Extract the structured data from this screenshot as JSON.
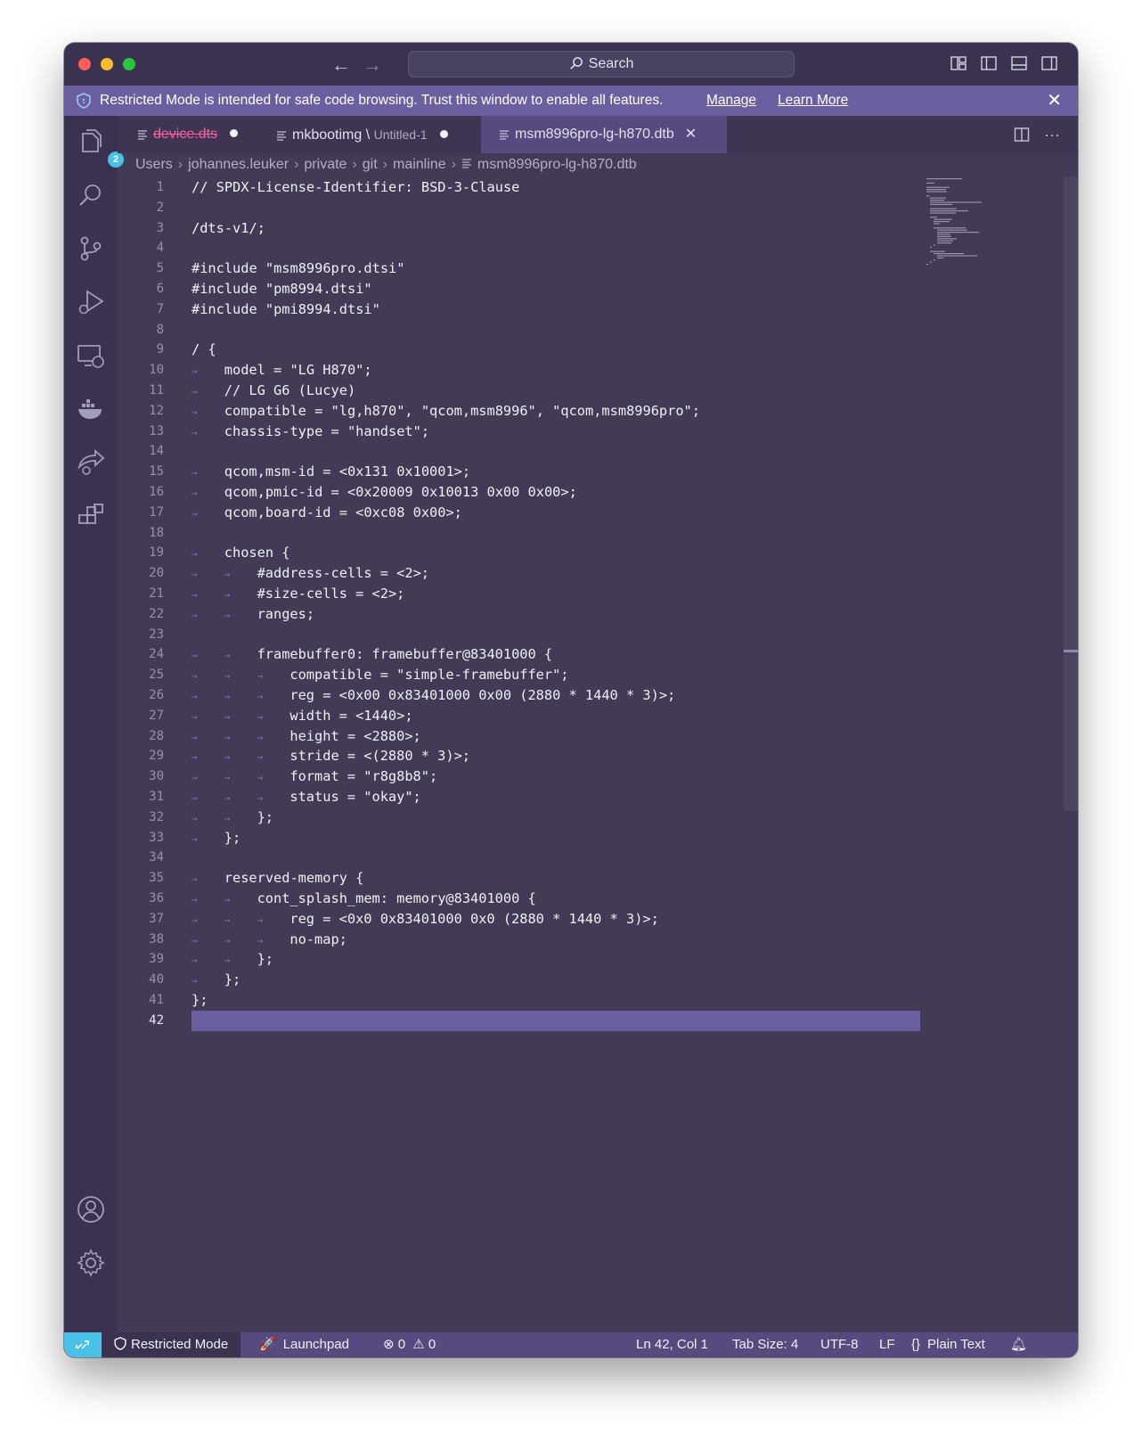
{
  "titlebar": {
    "search_label": "Search"
  },
  "banner": {
    "message": "Restricted Mode is intended for safe code browsing. Trust this window to enable all features.",
    "manage": "Manage",
    "learn_more": "Learn More"
  },
  "activity": {
    "explorer_badge": "2"
  },
  "tabs": [
    {
      "label": "device.dts",
      "dirty": true
    },
    {
      "label": "mkbootimg \\",
      "detail": "Untitled-1",
      "dirty": true
    },
    {
      "label": "msm8996pro-lg-h870.dtb",
      "active": true
    }
  ],
  "breadcrumbs": [
    "Users",
    "johannes.leuker",
    "private",
    "git",
    "mainline",
    "msm8996pro-lg-h870.dtb"
  ],
  "editor": {
    "lines": [
      "// SPDX-License-Identifier: BSD-3-Clause",
      "",
      "/dts-v1/;",
      "",
      "#include \"msm8996pro.dtsi\"",
      "#include \"pm8994.dtsi\"",
      "#include \"pmi8994.dtsi\"",
      "",
      "/ {",
      "\tmodel = \"LG H870\";",
      "\t// LG G6 (Lucye)",
      "\tcompatible = \"lg,h870\", \"qcom,msm8996\", \"qcom,msm8996pro\";",
      "\tchassis-type = \"handset\";",
      "",
      "\tqcom,msm-id = <0x131 0x10001>;",
      "\tqcom,pmic-id = <0x20009 0x10013 0x00 0x00>;",
      "\tqcom,board-id = <0xc08 0x00>;",
      "",
      "\tchosen {",
      "\t\t#address-cells = <2>;",
      "\t\t#size-cells = <2>;",
      "\t\tranges;",
      "",
      "\t\tframebuffer0: framebuffer@83401000 {",
      "\t\t\tcompatible = \"simple-framebuffer\";",
      "\t\t\treg = <0x00 0x83401000 0x00 (2880 * 1440 * 3)>;",
      "\t\t\twidth = <1440>;",
      "\t\t\theight = <2880>;",
      "\t\t\tstride = <(2880 * 3)>;",
      "\t\t\tformat = \"r8g8b8\";",
      "\t\t\tstatus = \"okay\";",
      "\t\t};",
      "\t};",
      "",
      "\treserved-memory {",
      "\t\tcont_splash_mem: memory@83401000 {",
      "\t\t\treg = <0x0 0x83401000 0x0 (2880 * 1440 * 3)>;",
      "\t\t\tno-map;",
      "\t\t};",
      "\t};",
      "};",
      ""
    ],
    "current_line": 42
  },
  "status": {
    "restricted": "Restricted Mode",
    "launchpad": "Launchpad",
    "errors": "0",
    "warnings": "0",
    "position": "Ln 42, Col 1",
    "tab_size": "Tab Size: 4",
    "encoding": "UTF-8",
    "eol": "LF",
    "language": "Plain Text"
  },
  "colors": {
    "accent": "#6c5fa0",
    "editor_bg": "#433b55",
    "remote": "#49c1e7",
    "dirty": "#ff5f9c"
  }
}
